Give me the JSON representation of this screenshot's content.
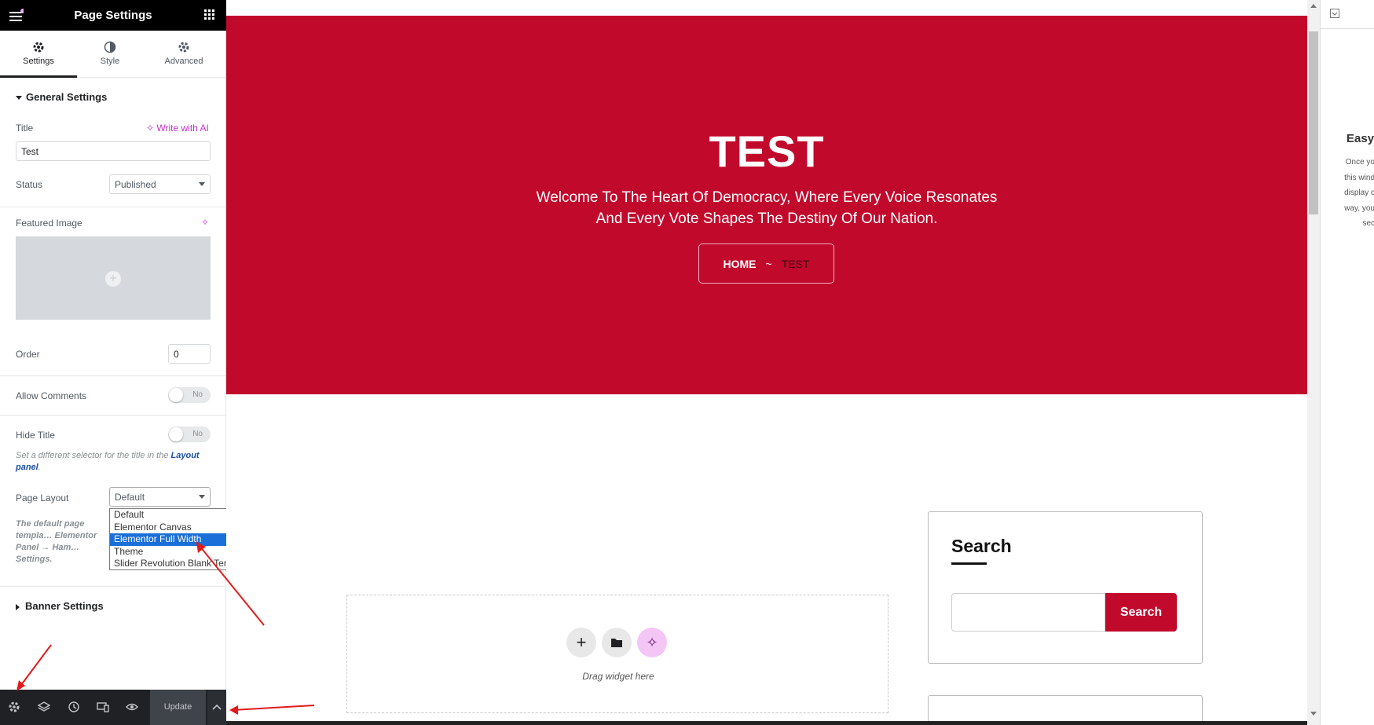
{
  "panel": {
    "title": "Page Settings",
    "tabs": [
      {
        "label": "Settings",
        "icon": "gear-icon"
      },
      {
        "label": "Style",
        "icon": "half-circle-icon"
      },
      {
        "label": "Advanced",
        "icon": "gear-icon"
      }
    ],
    "general_section": "General Settings",
    "title_label": "Title",
    "write_ai": "Write with AI",
    "title_value": "Test",
    "status_label": "Status",
    "status_value": "Published",
    "featured_label": "Featured Image",
    "order_label": "Order",
    "order_value": "0",
    "allow_comments_label": "Allow Comments",
    "allow_comments_value": "No",
    "hide_title_label": "Hide Title",
    "hide_title_value": "No",
    "hide_note_1": "Set a different selector for the title in the",
    "hide_note_link": "Layout panel",
    "hide_note_end": ".",
    "page_layout_label": "Page Layout",
    "page_layout_value": "Default",
    "layout_note": "The default page templa… Elementor Panel → Ham… Settings.",
    "layout_options": [
      "Default",
      "Elementor Canvas",
      "Elementor Full Width",
      "Theme",
      "Slider Revolution Blank Template"
    ],
    "highlighted_option": "Elementor Full Width",
    "banner_section": "Banner Settings",
    "update_label": "Update"
  },
  "hero": {
    "title": "TEST",
    "subtitle_1": "Welcome To The Heart Of Democracy, Where Every Voice Resonates",
    "subtitle_2": "And Every Vote Shapes The Destiny Of Our Nation.",
    "breadcrumb_home": "HOME",
    "breadcrumb_sep": "~",
    "breadcrumb_current": "TEST"
  },
  "content": {
    "drag_text": "Drag widget here",
    "search_title": "Search",
    "search_button": "Search"
  },
  "right_pane": {
    "title": "Easy",
    "lines": [
      "Once yo",
      "this wind",
      "display c",
      "way, you",
      "sec"
    ]
  },
  "colors": {
    "accent": "#c1092c",
    "panel_dark": "#1f2124",
    "ai_pink": "#c72fd1",
    "highlight": "#1b6fd8"
  }
}
